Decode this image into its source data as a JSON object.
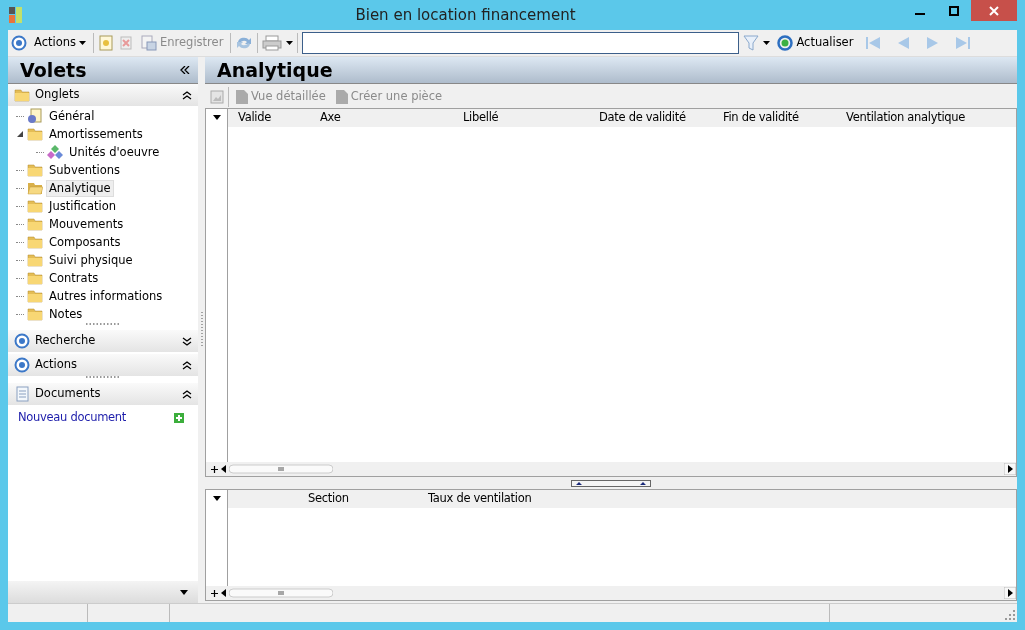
{
  "window": {
    "title": "Bien en location financement"
  },
  "toolbar": {
    "actions_menu": "Actions",
    "save": {
      "label": "Enregistrer",
      "disabled": true
    },
    "refresh": "Actualiser"
  },
  "sidebar": {
    "title": "Volets",
    "sections": [
      {
        "kind": "tree",
        "title": "Onglets",
        "expanded": true,
        "items": [
          {
            "label": "Général",
            "kind": "page",
            "selected": false
          },
          {
            "label": "Amortissements",
            "kind": "folder",
            "selected": false,
            "expanded": true,
            "children": [
              {
                "label": "Unités d'oeuvre",
                "kind": "shapes",
                "selected": false
              }
            ]
          },
          {
            "label": "Subventions",
            "kind": "folder",
            "selected": false
          },
          {
            "label": "Analytique",
            "kind": "folder",
            "selected": true
          },
          {
            "label": "Justification",
            "kind": "folder",
            "selected": false
          },
          {
            "label": "Mouvements",
            "kind": "folder",
            "selected": false
          },
          {
            "label": "Composants",
            "kind": "folder",
            "selected": false
          },
          {
            "label": "Suivi physique",
            "kind": "folder",
            "selected": false
          },
          {
            "label": "Contrats",
            "kind": "folder",
            "selected": false
          },
          {
            "label": "Autres informations",
            "kind": "folder",
            "selected": false
          },
          {
            "label": "Notes",
            "kind": "folder",
            "selected": false
          }
        ]
      },
      {
        "kind": "search",
        "title": "Recherche",
        "expanded": false
      },
      {
        "kind": "actions",
        "title": "Actions",
        "expanded": true
      },
      {
        "kind": "documents",
        "title": "Documents",
        "expanded": true,
        "link": "Nouveau document"
      }
    ]
  },
  "main": {
    "title": "Analytique",
    "toolbar": [
      {
        "label": "Vue détaillée",
        "disabled": true
      },
      {
        "label": "Créer une pièce",
        "disabled": true
      }
    ],
    "grid": {
      "columns": [
        "Valide",
        "Axe",
        "Libellé",
        "Date de validité",
        "Fin de validité",
        "Ventilation analytique"
      ]
    },
    "detail_grid": {
      "columns": [
        "Section",
        "Taux de ventilation"
      ]
    }
  }
}
